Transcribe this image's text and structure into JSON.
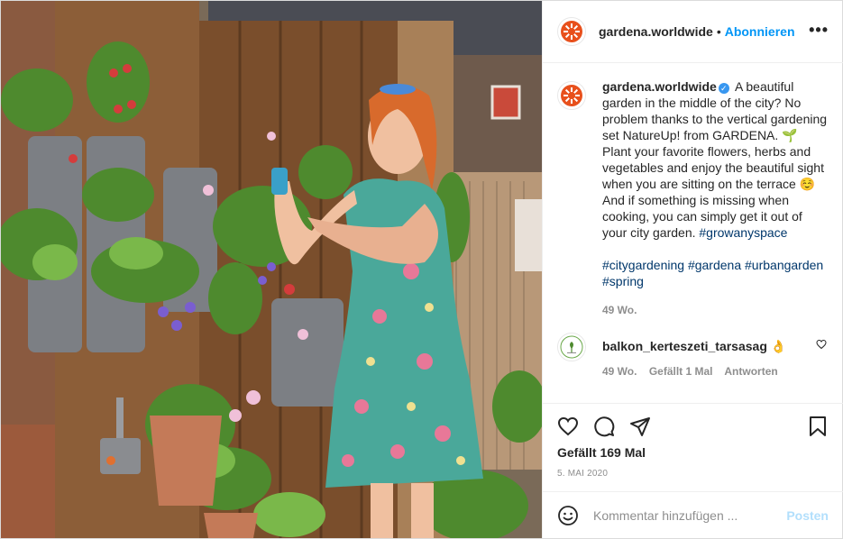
{
  "header": {
    "username": "gardena.worldwide",
    "separator": "•",
    "follow_label": "Abonnieren",
    "more_label": "•••"
  },
  "caption": {
    "username": "gardena.worldwide",
    "verified_mark": "✓",
    "text": "A beautiful garden in the middle of the city? No problem thanks to the vertical gardening set NatureUp! from GARDENA. 🌱 Plant your favorite flowers, herbs and vegetables and enjoy the beautiful sight when you are sitting on the terrace ☺️ And if something is missing when cooking, you can simply get it out of your city garden.",
    "inline_hashtag": "#growanyspace",
    "hashtags": [
      "#citygardening",
      "#gardena",
      "#urbangarden",
      "#spring"
    ],
    "age": "49 Wo."
  },
  "comment": {
    "username": "balkon_kerteszeti_tarsasag",
    "text": "👌",
    "age": "49 Wo.",
    "likes": "Gefällt 1 Mal",
    "reply_label": "Antworten"
  },
  "actions": {
    "likes_text": "Gefällt 169 Mal",
    "date": "5. MAI 2020"
  },
  "comment_box": {
    "placeholder": "Kommentar hinzufügen ...",
    "post_label": "Posten"
  },
  "colors": {
    "accent": "#0095f6",
    "brand": "#e8501c",
    "verified": "#3897f0",
    "muted": "#8e8e8e"
  }
}
